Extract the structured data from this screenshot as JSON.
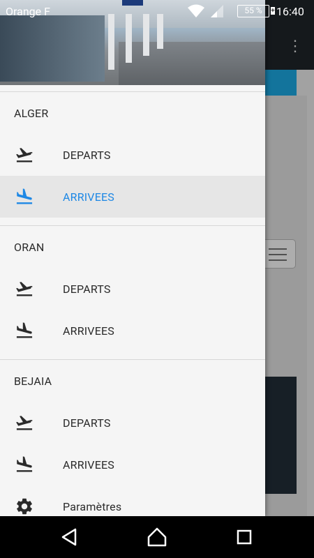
{
  "status": {
    "carrier": "Orange F",
    "battery": "55 %",
    "time": "16:40"
  },
  "drawer": {
    "sections": [
      {
        "title": "ALGER",
        "items": [
          {
            "label": "DEPARTS",
            "icon": "flight-takeoff-icon",
            "active": false
          },
          {
            "label": "ARRIVEES",
            "icon": "flight-land-icon",
            "active": true
          }
        ]
      },
      {
        "title": "ORAN",
        "items": [
          {
            "label": "DEPARTS",
            "icon": "flight-takeoff-icon",
            "active": false
          },
          {
            "label": "ARRIVEES",
            "icon": "flight-land-icon",
            "active": false
          }
        ]
      },
      {
        "title": "BEJAIA",
        "items": [
          {
            "label": "DEPARTS",
            "icon": "flight-takeoff-icon",
            "active": false
          },
          {
            "label": "ARRIVEES",
            "icon": "flight-land-icon",
            "active": false
          }
        ]
      }
    ],
    "settings_label": "Paramètres"
  },
  "colors": {
    "accent": "#1e88e5",
    "drawer_bg": "#f5f5f5",
    "active_bg": "#e6e6e6"
  }
}
